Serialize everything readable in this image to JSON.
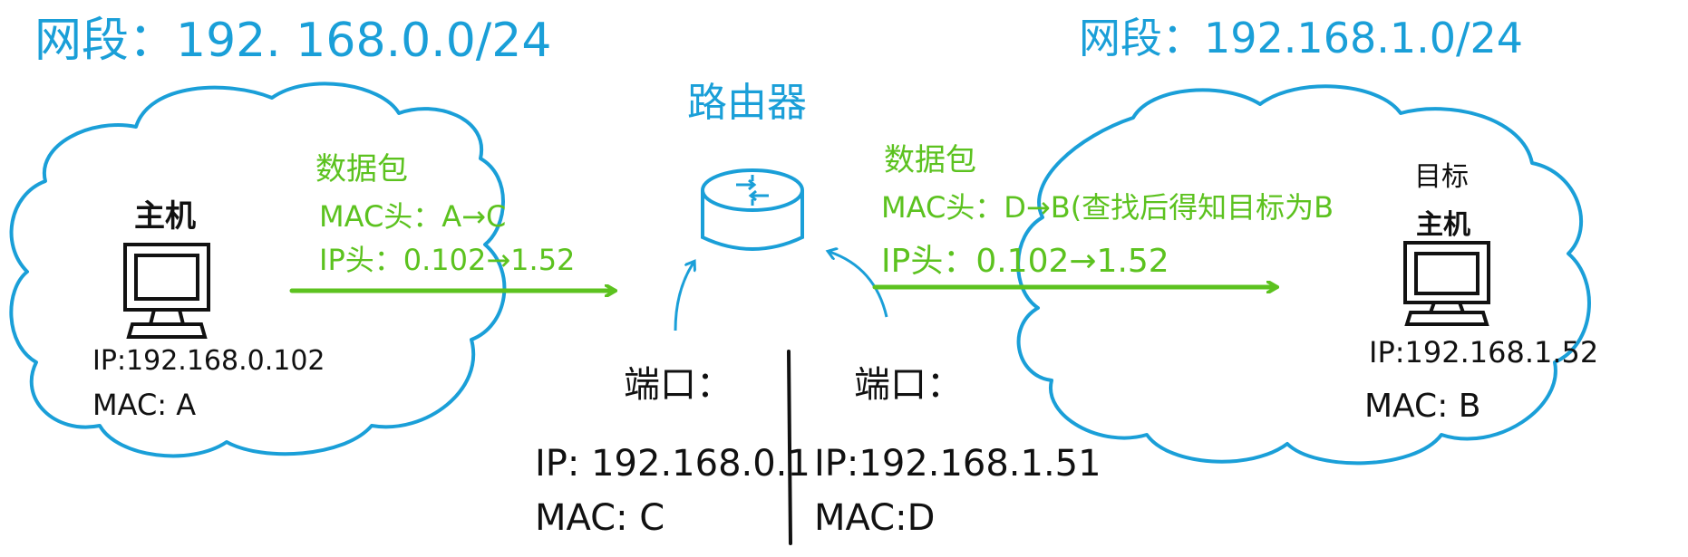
{
  "colors": {
    "cloud": "#1a9fd8",
    "packet": "#5cc21f",
    "ink": "#111111"
  },
  "left_network": {
    "title": "网段：192. 168.0.0/24",
    "host": {
      "label": "主机",
      "ip": "IP:192.168.0.102",
      "mac": "MAC: A"
    },
    "packet": {
      "title": "数据包",
      "mac_header": "MAC头：A→C",
      "ip_header": "IP头：0.102→1.52"
    }
  },
  "router": {
    "label": "路由器",
    "left_port": {
      "title": "端口：",
      "ip": "IP: 192.168.0.1",
      "mac": "MAC: C"
    },
    "right_port": {
      "title": "端口：",
      "ip": "IP:192.168.1.51",
      "mac": "MAC:D"
    }
  },
  "right_network": {
    "title": "网段：192.168.1.0/24",
    "host": {
      "label_line1": "目标",
      "label_line2": "主机",
      "ip": "IP:192.168.1.52",
      "mac": "MAC: B"
    },
    "packet": {
      "title": "数据包",
      "mac_header": "MAC头：D→B(查找后得知目标为B",
      "ip_header": "IP头：0.102→1.52"
    }
  }
}
